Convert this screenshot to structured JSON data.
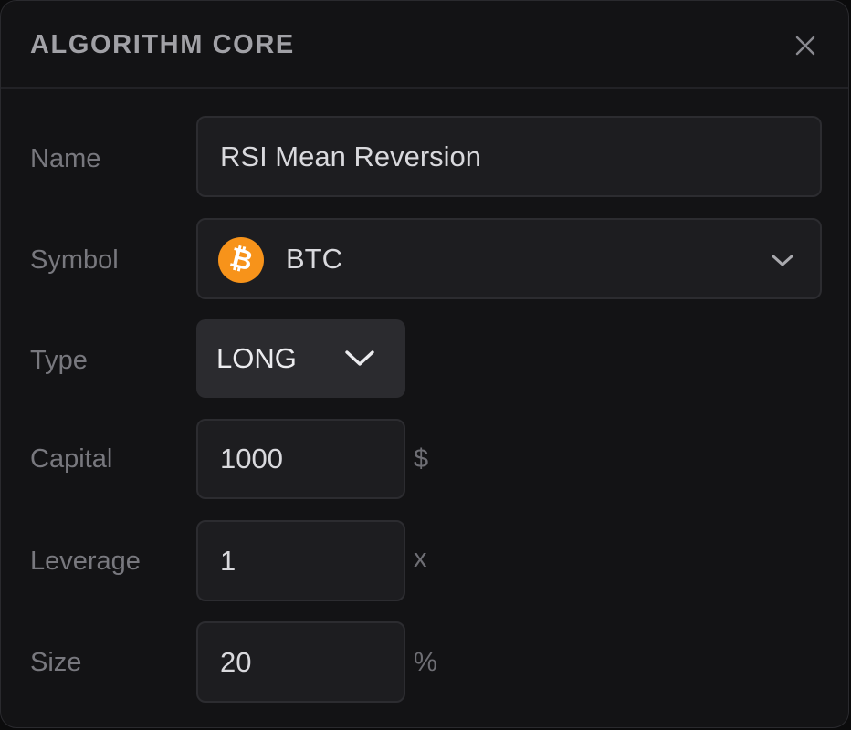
{
  "header": {
    "title": "ALGORITHM CORE",
    "close_icon": "close-icon"
  },
  "form": {
    "name": {
      "label": "Name",
      "value": "RSI Mean Reversion"
    },
    "symbol": {
      "label": "Symbol",
      "value": "BTC",
      "icon": "bitcoin-icon",
      "icon_glyph": "₿",
      "icon_color": "#f7931a",
      "dropdown_icon": "chevron-down-icon"
    },
    "type": {
      "label": "Type",
      "value": "LONG",
      "dropdown_icon": "chevron-down-icon"
    },
    "capital": {
      "label": "Capital",
      "value": "1000",
      "unit": "$"
    },
    "leverage": {
      "label": "Leverage",
      "value": "1",
      "unit": "x"
    },
    "size": {
      "label": "Size",
      "value": "20",
      "unit": "%"
    }
  },
  "colors": {
    "background": "#131315",
    "field": "#1d1d20",
    "type_button": "#2b2b2f",
    "label": "#78787e",
    "value": "#d9d9dd",
    "accent": "#f7931a"
  }
}
